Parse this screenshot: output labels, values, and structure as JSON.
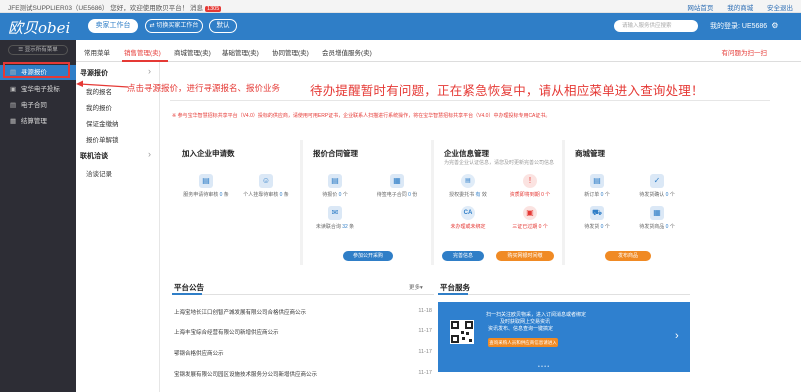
{
  "topbar": {
    "welcome": "JFE测试SUPPLIER03（UE5686）  您好，欢迎使用欧贝平台！ 消息",
    "msg_count": "1305",
    "links": [
      "网站首页",
      "我的商城",
      "安全退出"
    ]
  },
  "header": {
    "logo": "欧贝obei",
    "seller_btn": "卖家工作台",
    "buyer_btn": "⇄ 切换买家工作台",
    "default_btn": "默认",
    "search_placeholder": "请输入服务供应搜索",
    "user": "我的登录: UE5686"
  },
  "sidebar": {
    "toggle": "☰ 显示所有菜单",
    "items": [
      {
        "label": "寻源报价",
        "icon": "▤"
      },
      {
        "label": "宝华电子投标",
        "icon": "▣"
      },
      {
        "label": "电子合同",
        "icon": "▤"
      },
      {
        "label": "结算管理",
        "icon": "▦"
      }
    ]
  },
  "tabs": {
    "items": [
      "常用菜单",
      "销售管理(卖)",
      "商城管理(卖)",
      "基础管理(卖)",
      "协同管理(卖)",
      "会员增值服务(卖)"
    ],
    "right": "有问题为扫一扫"
  },
  "submenu": {
    "groups": [
      {
        "label": "寻源报价",
        "items": [
          "我的报名",
          "我的报价",
          "保证金缴纳",
          "报价单解锁"
        ]
      },
      {
        "label": "联机洽谈",
        "items": [
          "洽谈记录"
        ]
      }
    ]
  },
  "annotations": {
    "small": "点击寻源报价，进行寻源报名、报价业务",
    "big": "待办提醒暂时有问题，正在紧急恢复中，请从相应菜单进入查询处理！"
  },
  "long_notice": "※ 参与宝华智慧招标共享平台（V4.0）投标的供应商，请使用可用ERP证书，企业联系人扫描进行系统操作，将在宝华智慧招标共享平台（V4.0）中办理投标专用CA证书。",
  "cards": {
    "enterprise_apply": {
      "title": "加入企业申请数",
      "cells": [
        {
          "label": "服务申请待审核",
          "num": "0",
          "unit": "条"
        },
        {
          "label": "个人挂靠待审核",
          "num": "0",
          "unit": "条"
        }
      ]
    },
    "quote_contract": {
      "title": "报价合同管理",
      "cells": [
        {
          "label": "待报价",
          "num": "0",
          "unit": "个"
        },
        {
          "label": "待签电子合同",
          "num": "0",
          "unit": "份"
        },
        {
          "label": "未读联合询",
          "num": "32",
          "unit": "条"
        }
      ],
      "pill": "参加公开采购"
    },
    "enterprise_info": {
      "title": "企业信息管理",
      "sub": "为完善企业认证信息，请您及时更新完善公司信息",
      "cells": [
        {
          "label": "授权委托书",
          "num": "有",
          "unit": "效"
        },
        {
          "label": "资质即将到期",
          "num": "0",
          "unit": "个"
        },
        {
          "label": "未办理或未绑定",
          "num": "",
          "unit": ""
        },
        {
          "label": "三证已过期",
          "num": "0",
          "unit": "个"
        }
      ],
      "ca": "CA",
      "pills": [
        "完善信息",
        "购买网银时间缴"
      ]
    },
    "mall": {
      "title": "商城管理",
      "cells": [
        {
          "label": "新订单",
          "num": "0",
          "unit": "个"
        },
        {
          "label": "待发货确认",
          "num": "0",
          "unit": "个"
        },
        {
          "label": "待发货",
          "num": "0",
          "unit": "个"
        },
        {
          "label": "待发货商品",
          "num": "0",
          "unit": "个"
        }
      ],
      "pill": "发布商品"
    }
  },
  "announcements": {
    "title": "平台公告",
    "more": "更多▾",
    "items": [
      {
        "text": "上海宝地长江口创智产城发展有限公司合格供应商公示",
        "date": "11-18"
      },
      {
        "text": "上海丰宝综合经营有限公司新增供应商公示",
        "date": "11-17"
      },
      {
        "text": "鄂钢合格供应商公示",
        "date": "11-17"
      },
      {
        "text": "宝钢发展有限公司园区设施技术服务分公司新增供应商公示",
        "date": "11-17"
      }
    ]
  },
  "services": {
    "title": "平台服务",
    "banner_line1": "扫一扫关注欧贝物采，进入订阅消息或者绑定",
    "banner_line2": "及时获取网上交易资讯",
    "banner_line3": "资讯发布、信息查询一键搞定",
    "banner_btn": "查询采购人员和供应商信息请进入",
    "dots": "• • • •"
  }
}
